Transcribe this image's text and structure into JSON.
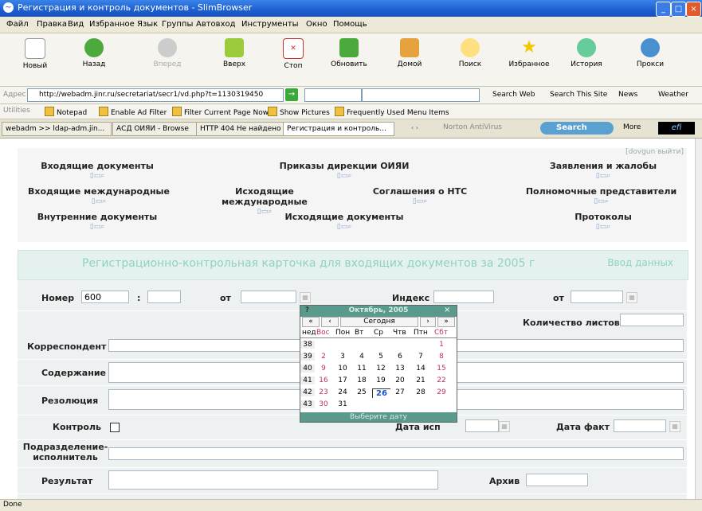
{
  "window": {
    "title": "Регистрация и контроль документов - SlimBrowser"
  },
  "menu": [
    "Файл",
    "Правка",
    "Вид",
    "Избранное",
    "Язык",
    "Группы",
    "Автовход",
    "Инструменты",
    "Окно",
    "Помощь"
  ],
  "toolbar": [
    "Новый",
    "Назад",
    "Вперед",
    "Вверх",
    "Стоп",
    "Обновить",
    "Домой",
    "Поиск",
    "Избранное",
    "История",
    "Прокси"
  ],
  "address": {
    "label": "Адрес",
    "url": "http://webadm.jinr.ru/secretariat/secr1/vd.php?t=1130319450",
    "search_web": "Search Web",
    "search_site": "Search This Site",
    "news": "News",
    "weather": "Weather"
  },
  "utilities": {
    "label": "Utilities",
    "items": [
      "Notepad",
      "Enable Ad Filter",
      "Filter Current Page Now",
      "Show Pictures",
      "Frequently Used Menu Items"
    ]
  },
  "tabs": [
    "webadm >> ldap-adm.jin...",
    "АСД ОИЯИ - Browse",
    "HTTP 404 Не найдено",
    "Регистрация и контроль..."
  ],
  "tabbar_right": {
    "norton": "Norton AntiVirus",
    "search": "Search",
    "more": "More"
  },
  "doc_links": "[dovgun выйти]",
  "doc_categories": [
    "Входящие документы",
    "Приказы дирекции ОИЯИ",
    "Заявления и жалобы",
    "Входящие международные",
    "Исходящие международные",
    "Соглашения о НТС",
    "Полномочные представители",
    "Внутренние документы",
    "Исходящие документы",
    "Протоколы"
  ],
  "form": {
    "title": "Регистрационно-контрольная карточка для входящих документов за 2005 г",
    "data_entry": "Ввод данных",
    "labels": {
      "number": "Номер",
      "colon": ":",
      "from": "от",
      "index": "Индекс",
      "from2": "от",
      "sheets": "Количество листов",
      "correspondent": "Корреспондент",
      "content": "Содержание",
      "resolution": "Резолюция",
      "control": "Контроль",
      "date_exec": "Дата исп",
      "date_fact": "Дата факт",
      "department": "Подразделение-исполнитель",
      "result": "Результат",
      "archive": "Архив"
    },
    "number_value": "600"
  },
  "calendar": {
    "month": "Октябрь, 2005",
    "help": "?",
    "close": "×",
    "prev_year": "«",
    "prev": "‹",
    "today": "Сегодня",
    "next": "›",
    "next_year": "»",
    "week_label": "нед",
    "days": [
      "Вос",
      "Пон",
      "Вт",
      "Ср",
      "Чтв",
      "Птн",
      "Сбт"
    ],
    "weeks": [
      {
        "w": "38",
        "d": [
          "",
          "",
          "",
          "",
          "",
          "",
          "1"
        ]
      },
      {
        "w": "39",
        "d": [
          "2",
          "3",
          "4",
          "5",
          "6",
          "7",
          "8"
        ]
      },
      {
        "w": "40",
        "d": [
          "9",
          "10",
          "11",
          "12",
          "13",
          "14",
          "15"
        ]
      },
      {
        "w": "41",
        "d": [
          "16",
          "17",
          "18",
          "19",
          "20",
          "21",
          "22"
        ]
      },
      {
        "w": "42",
        "d": [
          "23",
          "24",
          "25",
          "26",
          "27",
          "28",
          "29"
        ]
      },
      {
        "w": "43",
        "d": [
          "30",
          "31",
          "",
          "",
          "",
          "",
          ""
        ]
      }
    ],
    "footer": "Выберите дату"
  },
  "status": {
    "text": "Done"
  },
  "colors": {
    "titlebar": "#1d5fd0",
    "form_header": "#8fd2c4",
    "calendar_bar": "#5a9a8c",
    "weekend": "#c0305a",
    "today": "#1a50c0"
  }
}
